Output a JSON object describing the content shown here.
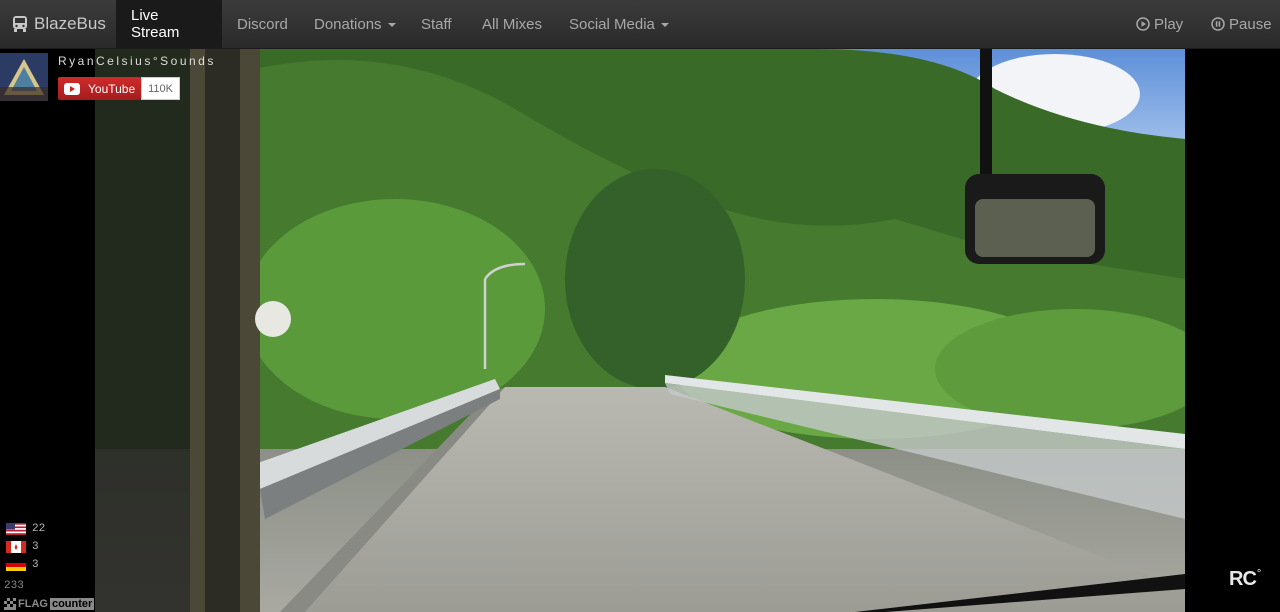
{
  "navbar": {
    "brand": "BlazeBus",
    "items": [
      {
        "label": "Live Stream",
        "active": true
      },
      {
        "label": "Discord"
      },
      {
        "label": "Donations",
        "dropdown": true
      },
      {
        "label": "Staff"
      },
      {
        "label": "All Mixes"
      },
      {
        "label": "Social Media",
        "dropdown": true
      }
    ],
    "controls": {
      "play": "Play",
      "pause": "Pause"
    }
  },
  "channel": {
    "name": "RyanCelsius°Sounds",
    "youtube_label": "YouTube",
    "subscriber_count": "110K"
  },
  "flag_counter": {
    "entries": [
      {
        "country": "us-flag-icon",
        "count": "22"
      },
      {
        "country": "ca-flag-icon",
        "count": "3"
      },
      {
        "country": "de-flag-icon",
        "count": "3"
      }
    ],
    "total": "233",
    "brand_flag": "FLAG",
    "brand_counter": "counter"
  },
  "watermark": {
    "text": "RC",
    "mark": "°"
  },
  "colors": {
    "navbar": "#333333",
    "active": "#1a1a1a",
    "youtube_red": "#c42424"
  }
}
